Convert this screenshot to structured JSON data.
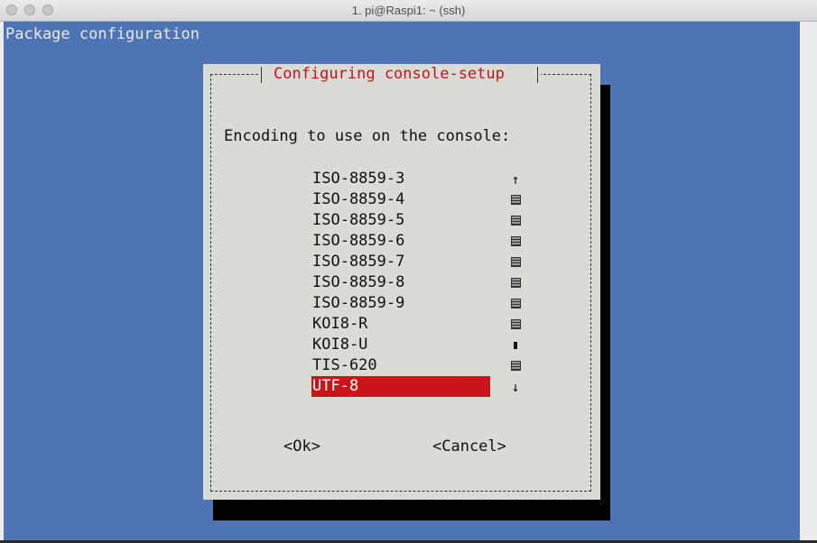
{
  "window": {
    "title": "1. pi@Raspi1: ~ (ssh)"
  },
  "terminal": {
    "header": "Package configuration"
  },
  "dialog": {
    "title": "Configuring console-setup",
    "prompt": "Encoding to use on the console:",
    "items": [
      {
        "label": "ISO-8859-3",
        "selected": false
      },
      {
        "label": "ISO-8859-4",
        "selected": false
      },
      {
        "label": "ISO-8859-5",
        "selected": false
      },
      {
        "label": "ISO-8859-6",
        "selected": false
      },
      {
        "label": "ISO-8859-7",
        "selected": false
      },
      {
        "label": "ISO-8859-8",
        "selected": false
      },
      {
        "label": "ISO-8859-9",
        "selected": false
      },
      {
        "label": "KOI8-R",
        "selected": false
      },
      {
        "label": "KOI8-U",
        "selected": false
      },
      {
        "label": "TIS-620",
        "selected": false
      },
      {
        "label": "UTF-8",
        "selected": true
      }
    ],
    "scrollbar": [
      "up-arrow-icon",
      "track-icon",
      "track-icon",
      "track-icon",
      "track-icon",
      "track-icon",
      "track-icon",
      "track-icon",
      "thumb-icon",
      "track-icon",
      "down-arrow-icon"
    ],
    "ok_label": "<Ok>",
    "cancel_label": "<Cancel>"
  },
  "colors": {
    "terminal_bg": "#4f74b3",
    "dialog_bg": "#d8dcd4",
    "accent_red": "#c9151a"
  }
}
